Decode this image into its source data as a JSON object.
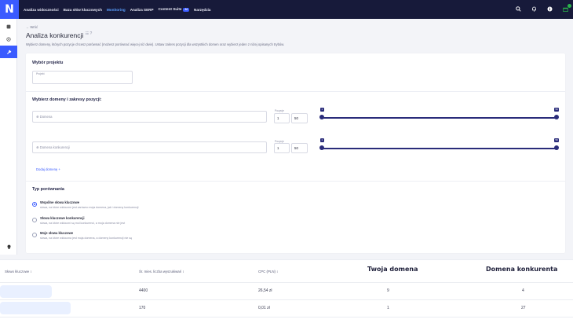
{
  "topbar": {
    "logo": "N",
    "nav": [
      {
        "label": "Analiza widoczności"
      },
      {
        "label": "Baza słów kluczowych"
      },
      {
        "label": "Monitoring"
      },
      {
        "label": "Analiza SERP"
      },
      {
        "label": "Content Suite",
        "badge": "AI"
      },
      {
        "label": "Narzędzia"
      }
    ],
    "icons": [
      "search-icon",
      "bell-icon",
      "info-icon",
      "gift-icon"
    ]
  },
  "sidebar": {
    "icons": [
      "dashboard-icon",
      "target-icon",
      "tools-icon",
      "bulb-icon"
    ]
  },
  "header": {
    "back": "← Wróć",
    "title": "Analiza konkurencji",
    "title_sup": "☷ ?",
    "description": "Wybierz domeny, których pozycje chcesz porównać (możesz porównać więcej niż dwie). Ustaw zakres pozycji dla wszystkich domen oraz wybierz jeden z niżej opisanych trybów."
  },
  "project": {
    "section_title": "Wybór projektu",
    "field_label": "Projekt"
  },
  "domains": {
    "section_title": "Wybierz domeny i zakresy pozycji:",
    "range_label": "Pozycje",
    "rows": [
      {
        "placeholder": "Domena",
        "from": "1",
        "to": "50",
        "min_tag": "1",
        "max_tag": "50"
      },
      {
        "placeholder": "Domena konkurencji",
        "from": "1",
        "to": "50",
        "min_tag": "1",
        "max_tag": "50"
      }
    ],
    "add_link": "Dodaj domenę +"
  },
  "comparison": {
    "section_title": "Typ porównania",
    "options": [
      {
        "title": "Wspólne słowa kluczowe",
        "desc": "słowa, na które widoczne jest zarówno moja domena, jak i domeny konkurencji"
      },
      {
        "title": "Słowa kluczowe konkurencji",
        "desc": "słowa, na które widoczni są moi konkurenci, a moja domena nie jest"
      },
      {
        "title": "Moje słowa kluczowe",
        "desc": "słowa, na które widoczna jest moja domena, a domeny konkurencji nie są"
      }
    ]
  },
  "table": {
    "headers": {
      "keyword": "Słowo kluczowe ↕",
      "volume": "Śr. mies. liczba wyszukiwań ↕",
      "cpc": "CPC (PLN) ↕",
      "my_domain": "Twoja domena",
      "competitor": "Domena konkurenta"
    },
    "rows": [
      {
        "volume": "4400",
        "cpc": "26,54 zł",
        "my": "9",
        "comp": "4"
      },
      {
        "volume": "170",
        "cpc": "0,01 zł",
        "my": "1",
        "comp": "27"
      }
    ]
  }
}
